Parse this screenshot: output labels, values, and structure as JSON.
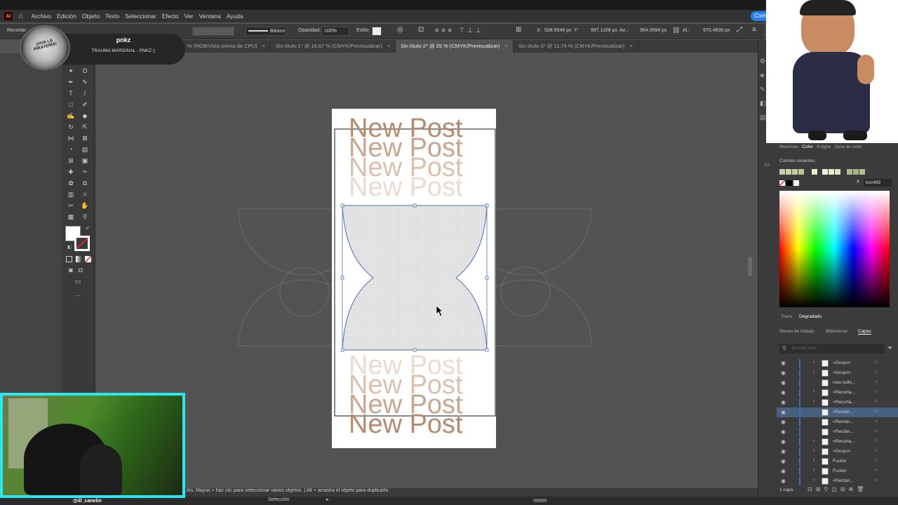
{
  "app": {
    "logo": "Ai",
    "menu": [
      "Archivo",
      "Edición",
      "Objeto",
      "Texto",
      "Seleccionar",
      "Efecto",
      "Ver",
      "Ventana",
      "Ayuda"
    ],
    "share_label": "Compartir"
  },
  "control_bar": {
    "mode_label": "Recortar",
    "stroke_style": "Básico",
    "opacity_label": "Opacidad:",
    "opacity_value": "100%",
    "style_label": "Estilo:",
    "x_label": "X:",
    "x_value": "538.6548 px",
    "y_label": "Y:",
    "y_value": "997.1168 px",
    "w_label": "An.:",
    "w_value": "964.0584 px",
    "h_label": "Al.:",
    "h_value": "970.4938 px"
  },
  "tabs": [
    {
      "label": "% (RGB/Vista previa de CPU)",
      "active": false
    },
    {
      "label": "Sin título-1* @ 16.67 % (CMYK/Previsualizar)",
      "active": false
    },
    {
      "label": "Sin título-2* @ 25 % (CMYK/Previsualizar)",
      "active": true
    },
    {
      "label": "Sin título-3* @ 11.74 % (CMYK/Previsualizar)",
      "active": false
    }
  ],
  "profile": {
    "name": "pnkz",
    "subtitle": "TRAUMA MARGINAL - PNKZ ▯",
    "badge_text": "¡VIVA LA PIRATERÍA!"
  },
  "artboard": {
    "headline": "New Post",
    "colors": {
      "tan": "#b58b70",
      "selection": "#4d6fb5"
    }
  },
  "status": {
    "hint": "...rks.   Mayús + haz clic para seleccionar varios objetos.   |   Alt + arrastra el objeto para duplicarlo.",
    "tool": "Selección"
  },
  "webcam": {
    "handle": "@ill_canelin"
  },
  "right_panel": {
    "panel_tabs": [
      "Muestras",
      "Color",
      "Kotype",
      "Guía de color"
    ],
    "recent_colors_label": "Colores recientes",
    "hex_value": "bcc499",
    "recent_colors": [
      "#c7d1a9",
      "#c8d3aa",
      "#bfcaa0",
      "#bcc499",
      "#e3ecc2",
      "#f0f3d8",
      "#e6ecd0",
      "#dfe6c6",
      "#aebb8e",
      "#a8b58a",
      "#b1bd92"
    ],
    "subtabs": [
      "Trazo",
      "Degradado"
    ],
    "section_tabs": [
      "Mesas de trabajo",
      "Bibliotecas",
      "Capas"
    ],
    "search_placeholder": "Buscar todo",
    "layers": [
      {
        "label": "<Grupo>",
        "arrow": true,
        "selected": false
      },
      {
        "label": "<Grupo>",
        "arrow": true,
        "selected": false
      },
      {
        "label": "new colle...",
        "arrow": false,
        "selected": false
      },
      {
        "label": "<Recorta...",
        "arrow": true,
        "selected": false
      },
      {
        "label": "<Recorta...",
        "arrow": true,
        "selected": false
      },
      {
        "label": "<Rectán...",
        "arrow": false,
        "selected": true
      },
      {
        "label": "<Rectán...",
        "arrow": false,
        "selected": false
      },
      {
        "label": "<Rectán...",
        "arrow": false,
        "selected": false
      },
      {
        "label": "<Recorta...",
        "arrow": true,
        "selected": false
      },
      {
        "label": "<Grupo>",
        "arrow": true,
        "selected": false
      },
      {
        "label": "Fusión",
        "arrow": true,
        "selected": false
      },
      {
        "label": "Fusión",
        "arrow": true,
        "selected": false
      },
      {
        "label": "<Rectán...",
        "arrow": true,
        "selected": false
      }
    ],
    "layer_count": "1 capa"
  }
}
